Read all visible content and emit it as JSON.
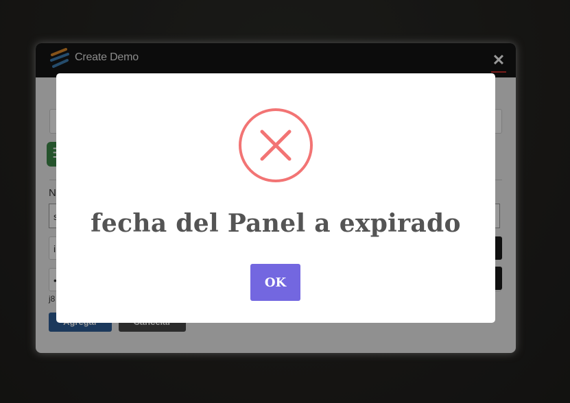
{
  "window": {
    "title": "Create Demo",
    "close_label": "✕"
  },
  "form": {
    "menu_icon_glyph": "☰",
    "name_label": "N",
    "name_value": "s",
    "field2_value": "i",
    "field3_value": "•",
    "hint_text": "j8",
    "add_label": "Agregar",
    "cancel_label": "Cancelar"
  },
  "alert": {
    "icon": "error-x-icon",
    "message": "fecha del Panel a expirado",
    "ok_label": "OK",
    "colors": {
      "icon": "#f27474",
      "button": "#7367e0"
    }
  }
}
